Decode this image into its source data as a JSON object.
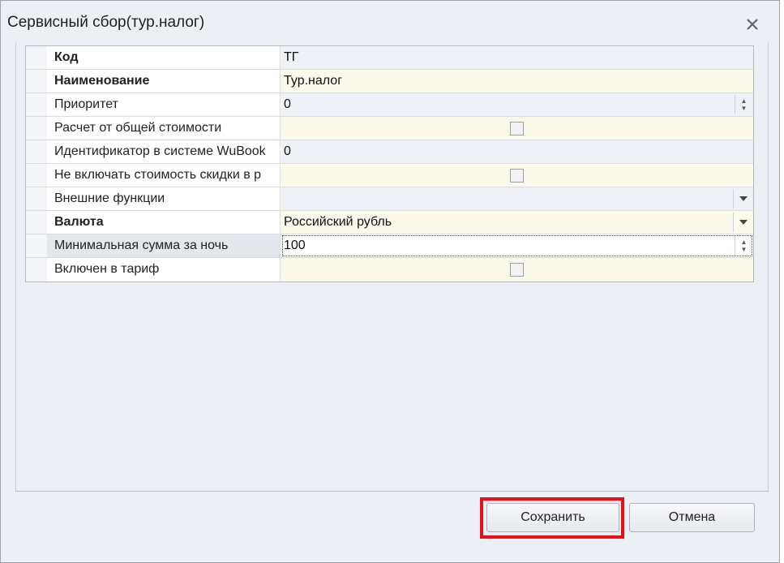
{
  "window": {
    "title": "Сервисный сбор(тур.налог)"
  },
  "properties": [
    {
      "label": "Код",
      "value": "ТГ",
      "bold": true
    },
    {
      "label": "Наименование",
      "value": "Тур.налог",
      "bold": true
    },
    {
      "label": "Приоритет",
      "value": "0",
      "bold": false
    },
    {
      "label": "Расчет от общей стоимости",
      "value": "",
      "bold": false,
      "checked": false
    },
    {
      "label": "Идентификатор в системе WuBook",
      "value": "0",
      "bold": false
    },
    {
      "label": "Не включать стоимость скидки в р",
      "value": "",
      "bold": false,
      "checked": false
    },
    {
      "label": "Внешние функции",
      "value": "",
      "bold": false
    },
    {
      "label": "Валюта",
      "value": "Российский рубль",
      "bold": true
    },
    {
      "label": "Минимальная сумма за ночь",
      "value": "100",
      "bold": false
    },
    {
      "label": "Включен в тариф",
      "value": "",
      "bold": false,
      "checked": false
    }
  ],
  "buttons": {
    "save": "Сохранить",
    "cancel": "Отмена"
  },
  "colors": {
    "highlight": "#e8101a",
    "field_cream": "#fbf9ea",
    "field_grey": "#eef1f6"
  },
  "icons": {
    "close": "close-icon",
    "globe": "globe-icon",
    "spin": "spin-arrows-icon",
    "dropdown": "chevron-down-icon"
  }
}
